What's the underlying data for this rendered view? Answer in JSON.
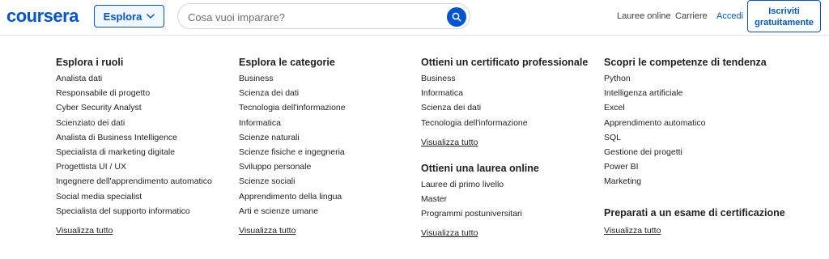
{
  "header": {
    "logo": "coursera",
    "explore_label": "Esplora",
    "search_placeholder": "Cosa vuoi imparare?",
    "links": {
      "online_degrees": "Lauree online",
      "careers": "Carriere",
      "login": "Accedi"
    },
    "signup_line1": "Iscriviti",
    "signup_line2": "gratuitamente",
    "accent_color": "#0056d2"
  },
  "menu": {
    "roles": {
      "title": "Esplora i ruoli",
      "items": [
        "Analista dati",
        "Responsabile di progetto",
        "Cyber Security Analyst",
        "Scienziato dei dati",
        "Analista di Business Intelligence",
        "Specialista di marketing digitale",
        "Progettista UI / UX",
        "Ingegnere dell'apprendimento automatico",
        "Social media specialist",
        "Specialista del supporto informatico"
      ],
      "more": "Visualizza tutto"
    },
    "categories": {
      "title": "Esplora le categorie",
      "items": [
        "Business",
        "Scienza dei dati",
        "Tecnologia dell'informazione",
        "Informatica",
        "Scienze naturali",
        "Scienze fisiche e ingegneria",
        "Sviluppo personale",
        "Scienze sociali",
        "Apprendimento della lingua",
        "Arti e scienze umane"
      ],
      "more": "Visualizza tutto"
    },
    "certificates": {
      "title": "Ottieni un certificato professionale",
      "items": [
        "Business",
        "Informatica",
        "Scienza dei dati",
        "Tecnologia dell'informazione"
      ],
      "more": "Visualizza tutto"
    },
    "degrees": {
      "title": "Ottieni una laurea online",
      "items": [
        "Lauree di primo livello",
        "Master",
        "Programmi postuniversitari"
      ],
      "more": "Visualizza tutto"
    },
    "skills": {
      "title": "Scopri le competenze di tendenza",
      "items": [
        "Python",
        "Intelligenza artificiale",
        "Excel",
        "Apprendimento automatico",
        "SQL",
        "Gestione dei progetti",
        "Power BI",
        "Marketing"
      ]
    },
    "exam": {
      "title": "Preparati a un esame di certificazione",
      "more": "Visualizza tutto"
    }
  }
}
